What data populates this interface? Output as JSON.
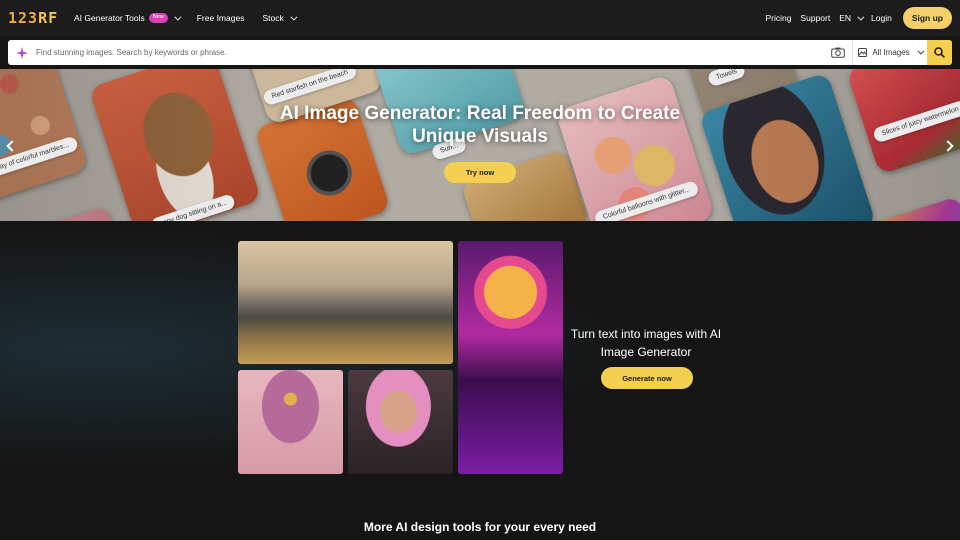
{
  "nav": {
    "logo": "123RF",
    "ai_tools": "AI Generator Tools",
    "new_badge": "New",
    "free_images": "Free Images",
    "stock": "Stock",
    "pricing": "Pricing",
    "support": "Support",
    "language": "EN",
    "login": "Login",
    "signup": "Sign up"
  },
  "search": {
    "placeholder": "Find stunning images. Search by keywords or phrase.",
    "scope": "All Images"
  },
  "hero": {
    "title": "AI Image Generator: Real Freedom to Create Unique Visuals",
    "cta": "Try now",
    "captions": [
      "Red starfish on the beach",
      "Towels",
      "Slices of juicy watermelon",
      "ray of colorful marbles...",
      "Sun...",
      "Colorful balloons with glitter...",
      "appy dog sitting on a..."
    ]
  },
  "promo": {
    "title": "Turn text into images with AI Image Generator",
    "cta": "Generate now"
  },
  "more": {
    "title": "More AI design tools for your every need"
  },
  "colors": {
    "accent": "#f5cf4f",
    "badge": "#d93fb6",
    "background": "#151515"
  }
}
